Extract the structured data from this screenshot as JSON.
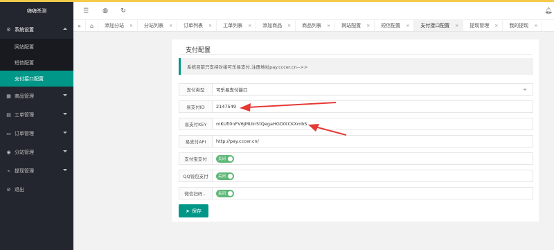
{
  "app": {
    "title": "嗨嗨杀测"
  },
  "sidebar": {
    "sections": [
      {
        "label": "系统设置",
        "icon": "gear-icon",
        "open": true,
        "items": [
          {
            "label": "网站配置"
          },
          {
            "label": "短信配置"
          },
          {
            "label": "支付接口配置",
            "active": true
          }
        ]
      },
      {
        "label": "商品管理",
        "icon": "grid-icon"
      },
      {
        "label": "工单管理",
        "icon": "ticket-icon"
      },
      {
        "label": "订单管理",
        "icon": "cart-icon"
      },
      {
        "label": "分站管理",
        "icon": "sitemap-icon"
      },
      {
        "label": "提现管理",
        "icon": "chart-icon"
      },
      {
        "label": "退出",
        "icon": "logout-icon"
      }
    ]
  },
  "tabs": [
    {
      "label": "添加分站"
    },
    {
      "label": "分站列表"
    },
    {
      "label": "订单列表"
    },
    {
      "label": "工单列表"
    },
    {
      "label": "添加商品"
    },
    {
      "label": "商品列表"
    },
    {
      "label": "网站配置"
    },
    {
      "label": "短信配置"
    },
    {
      "label": "支付接口配置",
      "active": true
    },
    {
      "label": "提现管理"
    },
    {
      "label": "我的提现"
    }
  ],
  "card": {
    "title": "支付配置",
    "notice": "系统目前只支持对接可乐易支付,注册地址pay.cccer.cn-->>",
    "fields": {
      "type": {
        "label": "支付类型",
        "value": "可乐易支付接口"
      },
      "id": {
        "label": "易支付ID",
        "value": "2147549"
      },
      "key": {
        "label": "易支付KEY",
        "value": "mKUfi0nFV6JMUin5tQegaHGD0tCKXmbS"
      },
      "api": {
        "label": "易支付API",
        "value": "http://pay.cccer.cn/"
      },
      "alipay": {
        "label": "支付宝支付",
        "toggle": "关闭"
      },
      "qq": {
        "label": "QQ钱包支付",
        "toggle": "关闭"
      },
      "wechat": {
        "label": "微信扫码...",
        "toggle": "关闭"
      }
    },
    "save_label": "保存"
  },
  "colors": {
    "accent": "#009688",
    "sidebar": "#23262e",
    "toggle": "#5fb878",
    "annotation": "#e53935"
  }
}
